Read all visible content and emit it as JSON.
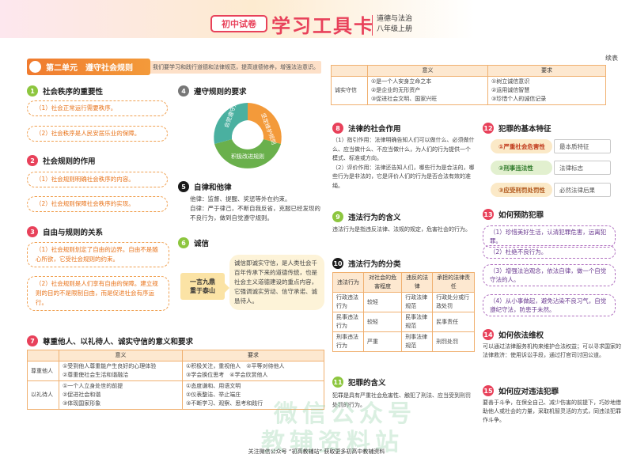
{
  "header": {
    "badge": "初中试卷",
    "title": "学习工具卡",
    "subject_line1": "道德与法治",
    "subject_line2": "八年级上册",
    "continued": "续表"
  },
  "unit": {
    "label": "第二单元　遵守社会规则",
    "desc": "我们要学习和践行道德和法律规范，提高道德修养，增强法治意识。"
  },
  "s1": {
    "num": "1",
    "title": "社会秩序的重要性",
    "items": [
      "（1）社会正常运行需要秩序。",
      "（2）社会秩序是人民安居乐业的保障。"
    ]
  },
  "s2": {
    "num": "2",
    "title": "社会规则的作用",
    "items": [
      "（1）社会规则明确社会秩序的内容。",
      "（2）社会规则保障社会秩序的实现。"
    ]
  },
  "s3": {
    "num": "3",
    "title": "自由与规则的关系",
    "items": [
      "（1）社会规则划定了自由的边界。自由不是随心所欲，它受社会规则的约束。",
      "（2）社会规则是人们享有自由的保障。建立规则的目的不是限制自由，而是促进社会有序运行。"
    ]
  },
  "s4": {
    "num": "4",
    "title": "遵守规则的要求",
    "cycle": [
      "自觉遵守规则",
      "坚定维护规则",
      "积极改进规则"
    ]
  },
  "s5": {
    "num": "5",
    "title": "自律和他律",
    "text1": "他律：监督、提醒、奖惩等外在约束。",
    "text2": "自律：严于律己，不断自我反省，克服已经发现的不良行为，做到自觉遵守规则。"
  },
  "s6": {
    "num": "6",
    "title": "诚信",
    "tag": "一言九鼎\n重于泰山",
    "text": "诚信即诚实守信，是人类社会千百年传承下来的道德传统，也是社会主义道德建设的重点内容，它强调诚实劳动、信守承诺、诚恳待人。"
  },
  "s7": {
    "num": "7",
    "title": "尊重他人、以礼待人、诚实守信的意义和要求",
    "headers": [
      "",
      "意义",
      "要求"
    ],
    "rows": [
      {
        "name": "尊重他人",
        "meaning": [
          "①受到他人尊重能产生良好的心理体验",
          "②尊重使社会生活和谐融洽"
        ],
        "req": [
          "①积极关注，重视他人",
          "②平等对待他人",
          "③学会换位思考",
          "④学会欣赏他人"
        ]
      },
      {
        "name": "以礼待人",
        "meaning": [
          "①一个人立身处世的前提",
          "②促进社会和谐",
          "③体现国家形象"
        ],
        "req": [
          "①态度谦和、用语文明",
          "②仪表整洁、举止端庄",
          "③不断学习、观察、思考和践行"
        ]
      }
    ]
  },
  "trow": {
    "headers": [
      "",
      "意义",
      "要求"
    ],
    "name": "诚实守信",
    "meaning": [
      "①是一个人安身立命之本",
      "②是企业的无形资产",
      "③促进社会文明、国家兴旺"
    ],
    "req": [
      "①树立诚信意识",
      "②运用诚信智慧",
      "③珍惜个人的诚信记录"
    ]
  },
  "s8": {
    "num": "8",
    "title": "法律的社会作用",
    "p1": "（1）指引作用：法律明确告知人们可以做什么、必须做什么、应当做什么、不应当做什么，为人们的行为提供一个模式、标准或方向。",
    "p2": "（2）评价作用：法律还告知人们，哪些行为是合法的，哪些行为是非法的，它是评价人们的行为是否合法有效的准绳。"
  },
  "s9": {
    "num": "9",
    "title": "违法行为的含义",
    "text": "违法行为是指违反法律、法规的规定，危害社会的行为。"
  },
  "s10": {
    "num": "10",
    "title": "违法行为的分类",
    "headers": [
      "违法行为",
      "对社会的危害程度",
      "违反的法律",
      "承担的法律责任"
    ],
    "rows": [
      [
        "行政违法行为",
        "较轻",
        "行政法律规范",
        "行政处分或行政处罚"
      ],
      [
        "民事违法行为",
        "较轻",
        "民事法律规范",
        "民事责任"
      ],
      [
        "刑事违法行为",
        "严重",
        "刑事法律规范",
        "刑罚处罚"
      ]
    ]
  },
  "s11": {
    "num": "11",
    "title": "犯罪的含义",
    "text": "犯罪是具有严重社会危害性、触犯了刑法、应当受到刑罚处罚的行为。"
  },
  "s12": {
    "num": "12",
    "title": "犯罪的基本特征",
    "features": [
      {
        "n": "①",
        "k": "严重社会危害性",
        "v": "最本质特征"
      },
      {
        "n": "②",
        "k": "刑事违法性",
        "v": "法律标志"
      },
      {
        "n": "③",
        "k": "应受刑罚处罚性",
        "v": "必然法律后果"
      }
    ]
  },
  "s13": {
    "num": "13",
    "title": "如何预防犯罪",
    "items": [
      "（1）珍惜美好生活，认清犯罪危害，远离犯罪。",
      "（2）杜绝不良行为。",
      "（3）增强法治观念，依法自律，做一个自觉守法的人。",
      "（4）从小事做起，避免沾染不良习气，自觉遵纪守法，防患于未然。"
    ]
  },
  "s14": {
    "num": "14",
    "title": "如何依法维权",
    "text": "可以通过法律服务机构来维护合法权益；可以寻求国家的法律救济：使用诉讼手段，通过打官司讨回公道。"
  },
  "s15": {
    "num": "15",
    "title": "如何应对违法犯罪",
    "text": "要善于斗争，在保全自己、减少伤害的前提下，巧妙地借助他人或社会的力量，采取机智灵活的方式，同违法犯罪作斗争。"
  },
  "footer": "关注微信公众号 “初高教辅站” 获取更多初高中教辅资料",
  "watermark1": "微信公众号",
  "watermark2": "教辅资料站",
  "colors": {
    "accent": "#e8415a",
    "orange": "#f39a3a",
    "green": "#8dc63f"
  }
}
